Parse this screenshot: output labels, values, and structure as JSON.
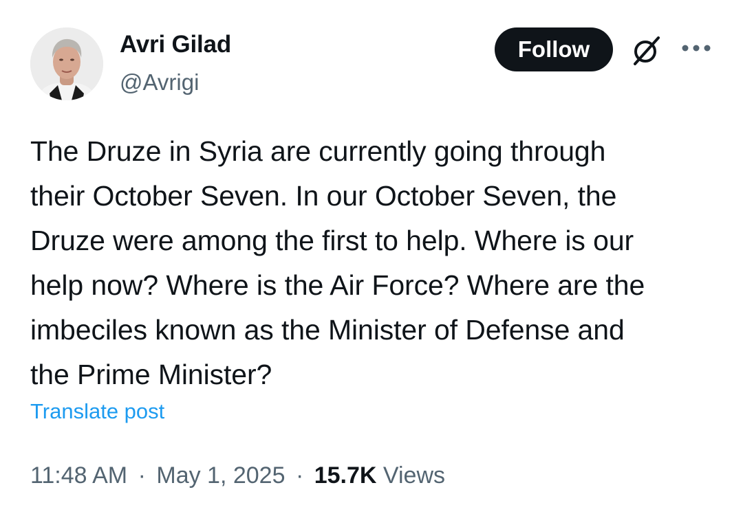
{
  "author": {
    "display_name": "Avri Gilad",
    "handle": "@Avrigi",
    "avatar_icon": "profile-photo"
  },
  "actions": {
    "follow_label": "Follow",
    "grok_icon": "grok-icon",
    "more_icon": "more-options-icon"
  },
  "post": {
    "text_lines": [
      "The Druze in Syria are currently going through",
      "their October Seven. In our October Seven, the",
      "Druze were among the first to help. Where is our",
      "help now? Where is the Air Force? Where are the",
      "imbeciles known as the Minister of Defense and",
      "the Prime Minister?"
    ],
    "translate_label": "Translate post"
  },
  "meta": {
    "time": "11:48 AM",
    "separator": "·",
    "date": "May 1, 2025",
    "views_count": "15.7K",
    "views_label": "Views"
  },
  "colors": {
    "text": "#0f1419",
    "secondary": "#536471",
    "link": "#1d9bf0",
    "button_bg": "#0f1419"
  }
}
